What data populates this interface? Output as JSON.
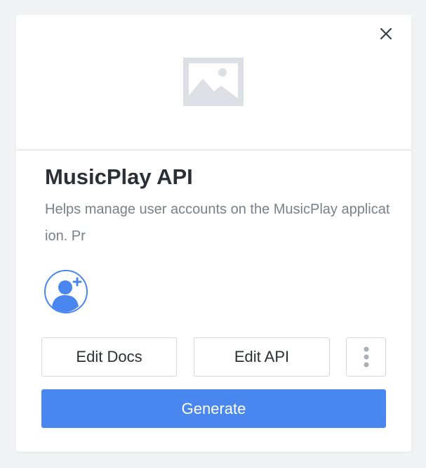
{
  "card": {
    "title": "MusicPlay API",
    "description": "Helps manage user accounts on the MusicPlay application. Pr"
  },
  "icons": {
    "close": "close-icon",
    "image": "image-placeholder-icon",
    "avatar": "add-user-icon",
    "more": "more-vertical-icon"
  },
  "actions": {
    "edit_docs_label": "Edit Docs",
    "edit_api_label": "Edit API",
    "generate_label": "Generate"
  },
  "colors": {
    "primary": "#4a86f0",
    "avatar_blue": "#4a86f0",
    "placeholder_gray": "#dcdfe4",
    "text_dark": "#2b2f36",
    "text_muted": "#7a8088"
  }
}
